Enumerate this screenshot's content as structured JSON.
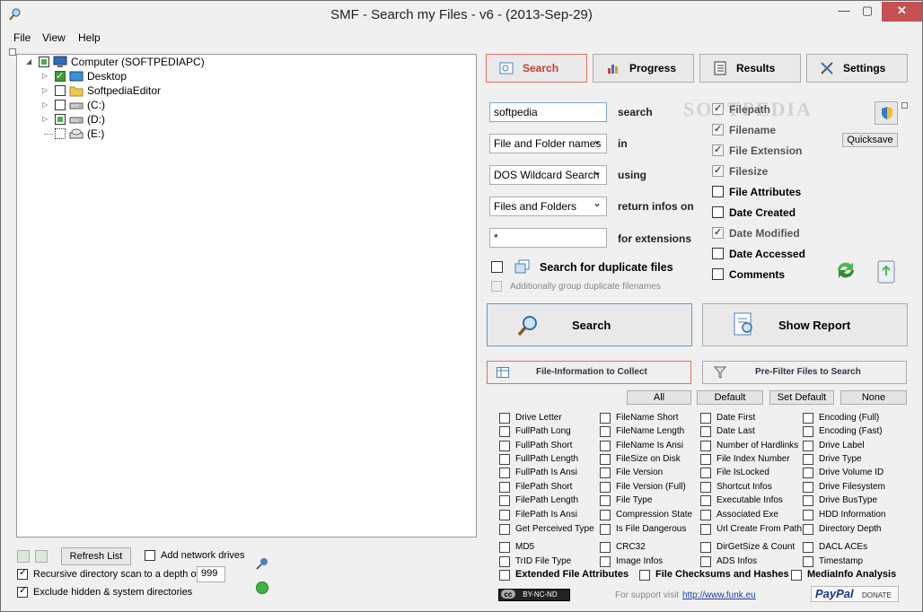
{
  "window": {
    "title": "SMF - Search my Files - v6 - (2013-Sep-29)",
    "min_glyph": "—",
    "max_glyph": "▢",
    "close_glyph": "✕"
  },
  "menu": [
    "File",
    "View",
    "Help"
  ],
  "tree": {
    "items": [
      {
        "label": "Computer (SOFTPEDIAPC)",
        "state": "partial",
        "icon": "computer-icon"
      },
      {
        "label": "Desktop",
        "state": "checked",
        "icon": "desktop-icon"
      },
      {
        "label": "SoftpediaEditor",
        "state": "unchecked",
        "icon": "folder-icon"
      },
      {
        "label": "(C:)",
        "state": "unchecked",
        "icon": "drive-icon"
      },
      {
        "label": "(D:)",
        "state": "partial",
        "icon": "drive-icon"
      },
      {
        "label": "(E:)",
        "state": "unchecked",
        "icon": "cd-drive-icon"
      }
    ]
  },
  "bottom_left": {
    "refresh_label": "Refresh List",
    "add_network_label": "Add network drives",
    "recursive_label": "Recursive directory scan to a depth of",
    "depth_value": "999",
    "exclude_label": "Exclude hidden & system directories"
  },
  "tabs": {
    "search": "Search",
    "progress": "Progress",
    "results": "Results",
    "settings": "Settings"
  },
  "form": {
    "search_value": "softpedia",
    "search_label": "search",
    "in_value": "File and Folder names",
    "in_label": "in",
    "using_value": "DOS Wildcard Search",
    "using_label": "using",
    "return_value": "Files and Folders",
    "return_label": "return infos on",
    "ext_value": "*",
    "ext_label": "for extensions",
    "duplicate_label": "Search for duplicate files",
    "group_label": "Additionally group duplicate filenames"
  },
  "options": [
    {
      "label": "Filepath",
      "on": true
    },
    {
      "label": "Filename",
      "on": true
    },
    {
      "label": "File Extension",
      "on": true
    },
    {
      "label": "Filesize",
      "on": true
    },
    {
      "label": "File Attributes",
      "on": false
    },
    {
      "label": "Date Created",
      "on": false
    },
    {
      "label": "Date Modified",
      "on": true
    },
    {
      "label": "Date Accessed",
      "on": false
    },
    {
      "label": "Comments",
      "on": false
    }
  ],
  "quicksave_label": "Quicksave",
  "watermark": "SOFTPEDIA",
  "actions": {
    "search_label": "Search",
    "report_label": "Show Report"
  },
  "subtabs": {
    "info_label": "File-Information to Collect",
    "prefilter_label": "Pre-Filter Files to Search"
  },
  "preset_buttons": [
    "All",
    "Default",
    "Set Default",
    "None"
  ],
  "file_info": {
    "col1": [
      "Drive Letter",
      "FullPath Long",
      "FullPath Short",
      "FullPath Length",
      "FullPath Is Ansi",
      "FilePath Short",
      "FilePath Length",
      "FilePath Is Ansi",
      "Get Perceived Type",
      "MD5",
      "TrID File Type"
    ],
    "col2": [
      "FileName Short",
      "FileName Length",
      "FileName Is Ansi",
      "FileSize on Disk",
      "File Version",
      "File Version (Full)",
      "File Type",
      "Compression State",
      "Is File Dangerous",
      "CRC32",
      "Image Infos"
    ],
    "col3": [
      "Date First",
      "Date Last",
      "Number of Hardlinks",
      "File Index Number",
      "File IsLocked",
      "Shortcut Infos",
      "Executable Infos",
      "Associated Exe",
      "Url Create From Path",
      "DirGetSize & Count",
      "ADS Infos"
    ],
    "col4": [
      "Encoding (Full)",
      "Encoding (Fast)",
      "Drive Label",
      "Drive Type",
      "Drive Volume ID",
      "Drive Filesystem",
      "Drive BusType",
      "HDD Information",
      "Directory Depth",
      "DACL ACEs",
      "Timestamp"
    ],
    "extended": [
      "Extended File Attributes",
      "File Checksums and Hashes",
      "MediaInfo Analysis"
    ]
  },
  "footer": {
    "license": "BY-NC-ND",
    "support_text": "For support visit",
    "url": "http://www.funk.eu",
    "paypal": "PayPal",
    "donate": "DONATE"
  }
}
